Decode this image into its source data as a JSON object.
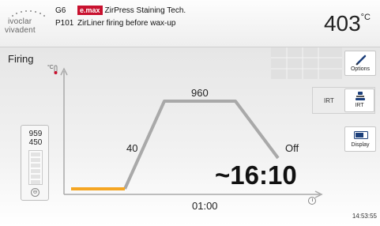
{
  "header": {
    "logo_line1": "ivoclar",
    "logo_line2": "vivadent",
    "program_group": "G6",
    "brand_badge": "e.max",
    "program_title": "ZirPress Staining Tech.",
    "program_number": "P101",
    "program_description": "ZirLiner firing before wax-up",
    "current_temperature": "403",
    "temperature_unit": "°C"
  },
  "main": {
    "title": "Firing",
    "temp_axis_unit": "°C"
  },
  "vacuum": {
    "value_top": "959",
    "value_bottom": "450",
    "icon": "vacuum-icon"
  },
  "firing_curve": {
    "heat_rate_label": "40",
    "holding_temperature_label": "960",
    "vacuum_off_label": "Off",
    "hold_time_label": "01:00",
    "remaining_time": "~16:10",
    "active_segment_color": "#f5a623",
    "curve_color": "#a9a9a9"
  },
  "side_buttons": {
    "options_label": "Options",
    "options_icon": "pen-icon",
    "irt_status": "IRT",
    "irt_label": "IRT",
    "irt_icon": "irt-icon",
    "display_label": "Display",
    "display_icon": "display-icon"
  },
  "status": {
    "time_of_day": "14:53:55",
    "clock_icon": "clock-icon"
  }
}
